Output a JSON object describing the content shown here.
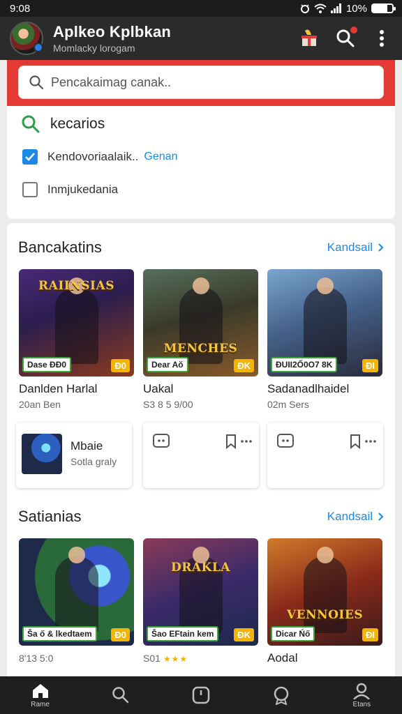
{
  "status_bar": {
    "time": "9:08",
    "battery_text": "10%",
    "battery_level": 0.75
  },
  "app_bar": {
    "title": "Aplkeo Kplbkan",
    "subtitle": "Momlacky lorogam"
  },
  "search": {
    "placeholder": "Pencakaimag canak..",
    "value": ""
  },
  "recent": {
    "title": "kecarios",
    "items": [
      {
        "label": "Kendovoriaalaik..",
        "link": "Genan",
        "checked": true
      },
      {
        "label": "Inmjukedania",
        "link": "",
        "checked": false
      }
    ]
  },
  "section1": {
    "title": "Bancakatins",
    "link": "Kandsail",
    "cards": [
      {
        "art_title": "RAIINSIAS",
        "tag_left": "Dase ĐĐ0",
        "tag_right": "Đ0",
        "name": "Danlden Harlal",
        "meta": "20an Ben"
      },
      {
        "art_title": "MENCHES",
        "tag_left": "Dear Aŏ",
        "tag_right": "ĐK",
        "name": "Uakal",
        "meta": "S3 8 5 9/00"
      },
      {
        "art_title": "",
        "tag_left": "ĐUII2Ő0O7 8K",
        "tag_right": "ĐI",
        "name": "Sadanadlhaidel",
        "meta": "02m Sers"
      }
    ],
    "mini_cards": [
      {
        "title": "Mbaie",
        "subtitle": "Sotla graly"
      }
    ]
  },
  "section2": {
    "title": "Satianias",
    "link": "Kandsail",
    "cards": [
      {
        "art_title": "",
        "tag_left": "Ša ő & lkedtaem",
        "tag_right": "Đ0",
        "name": "",
        "meta": "8'13 5:0"
      },
      {
        "art_title": "DRAKLA",
        "tag_left": "Šao EFtain kem",
        "tag_right": "ĐK",
        "name": "",
        "meta": "S01",
        "stars": "★★★"
      },
      {
        "art_title": "VENNOIES",
        "tag_left": "Dicar Ńő",
        "tag_right": "ĐI",
        "name": "Aodal",
        "meta": ""
      }
    ]
  },
  "bottom_nav": {
    "items": [
      {
        "label": "Rame",
        "icon": "home-icon",
        "active": true
      },
      {
        "label": "",
        "icon": "search-icon",
        "active": false
      },
      {
        "label": "",
        "icon": "clock-icon",
        "active": false
      },
      {
        "label": "",
        "icon": "badge-icon",
        "active": false
      },
      {
        "label": "Etans",
        "icon": "profile-icon",
        "active": false
      }
    ]
  },
  "colors": {
    "accent": "#1e88e5",
    "highlight": "#e53935",
    "badge": "#f4b400",
    "app_bar": "#2b2b2b"
  }
}
